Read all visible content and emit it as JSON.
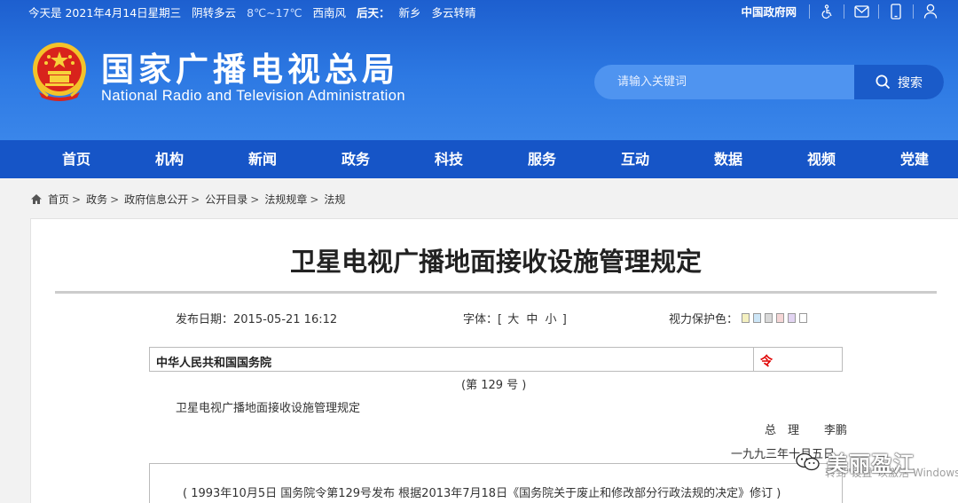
{
  "topbar": {
    "weather_text": "今天是 2021年4月14日星期三",
    "weather_cond": "阴转多云",
    "temp": "8℃~17℃",
    "wind": "西南风",
    "tomorrow_label": "后天：",
    "tomorrow_place": "新乡",
    "tomorrow_cond": "多云转晴",
    "gov_link": "中国政府网",
    "icons": [
      "accessibility-icon",
      "mail-icon",
      "mobile-icon",
      "user-icon"
    ]
  },
  "header": {
    "name_cn": "国家广播电视总局",
    "name_en": "National Radio and Television Administration",
    "search_placeholder": "请输入关键词",
    "search_button": "搜索"
  },
  "nav": {
    "items": [
      "首页",
      "机构",
      "新闻",
      "政务",
      "科技",
      "服务",
      "互动",
      "数据",
      "视频",
      "党建"
    ]
  },
  "breadcrumb": [
    "首页",
    "政务",
    "政府信息公开",
    "公开目录",
    "法规规章",
    "法规"
  ],
  "article": {
    "title": "卫星电视广播地面接收设施管理规定",
    "publish_date": "发布日期：2015-05-21 16:12",
    "font_label": "字体：[",
    "font_sizes": [
      "大",
      "中",
      "小"
    ],
    "font_close": "]",
    "eye_label": "视力保护色：",
    "eye_colors": [
      "#f4f0c0",
      "#cde6f7",
      "#d9d9d9",
      "#f5d6d6",
      "#e2d4f2",
      "#ffffff"
    ],
    "issuer": "中华人民共和国国务院",
    "decree": "令",
    "order_no": "(第 129 号 )",
    "regulation_name": "卫星电视广播地面接收设施管理规定",
    "premier_label": "总　理",
    "premier_name": "李鹏",
    "date_cn": "一九九三年十月五日",
    "note": "( 1993年10月5日 国务院令第129号发布  根据2013年7月18日《国务院关于废止和修改部分行政法规的决定》修订 )"
  },
  "overlay": {
    "watermark": "美丽盈江",
    "windows_hint": "转到\"设置\"以激活 Windows"
  },
  "colors": {
    "header_blue": "#2d79e3",
    "nav_blue": "#1655c7",
    "decree_red": "#e00000"
  }
}
